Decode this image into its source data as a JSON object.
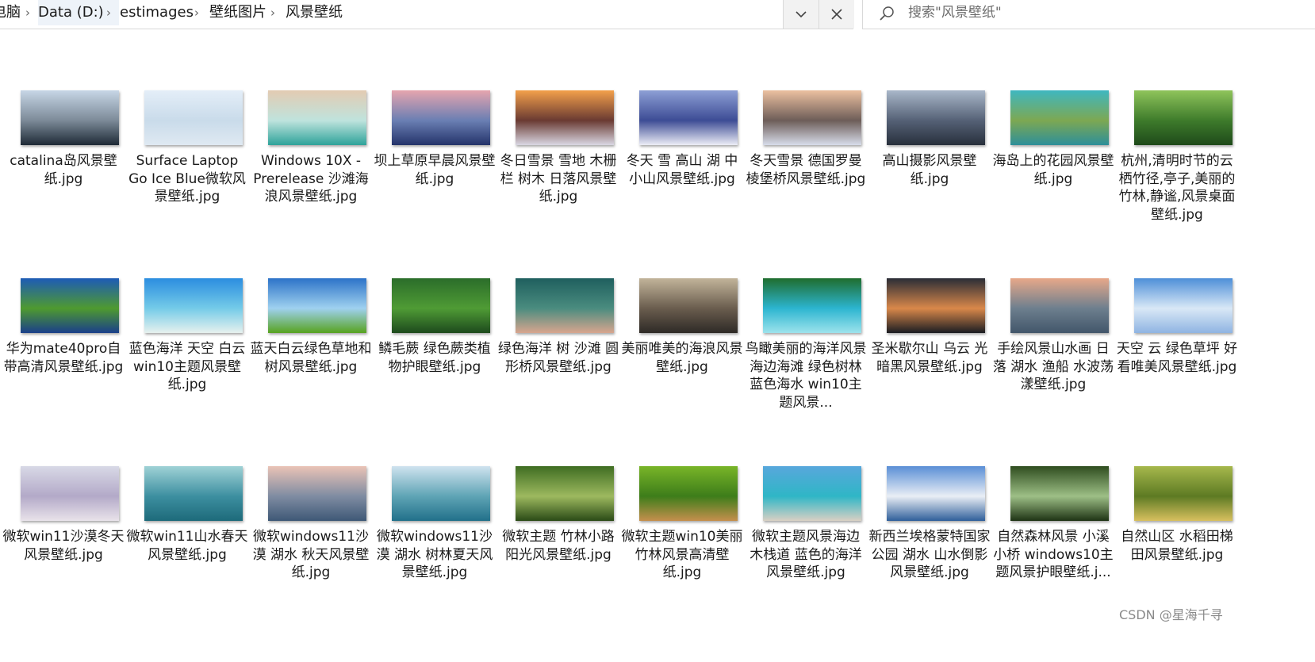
{
  "breadcrumb": {
    "items": [
      "电脑",
      "Data (D:)",
      "estimages",
      "壁纸图片",
      "风景壁纸"
    ]
  },
  "search": {
    "placeholder": "搜索\"风景壁纸\""
  },
  "icons": {
    "separator": "chevron-right-icon",
    "history_dropdown": "chevron-down-icon",
    "clear": "close-icon",
    "search": "search-icon"
  },
  "files": [
    {
      "name": "catalina岛风景壁纸.jpg",
      "colors": [
        "#c7d6e6",
        "#7c8a98",
        "#1e2a36"
      ]
    },
    {
      "name": "Surface Laptop Go Ice Blue微软风景壁纸.jpg",
      "colors": [
        "#e4eef8",
        "#c9dbea",
        "#dfe9f2"
      ]
    },
    {
      "name": "Windows 10X - Prerelease 沙滩海浪风景壁纸.jpg",
      "colors": [
        "#e3cbb2",
        "#bfe3dd",
        "#2ea39a"
      ]
    },
    {
      "name": "坝上草原早晨风景壁纸.jpg",
      "colors": [
        "#e6a5ae",
        "#6a7fb3",
        "#24336a"
      ]
    },
    {
      "name": "冬日雪景 雪地 木栅栏 树木 日落风景壁纸.jpg",
      "colors": [
        "#f3a04b",
        "#6a3a32",
        "#d9d7e3"
      ]
    },
    {
      "name": "冬天 雪 高山 湖 中小山风景壁纸.jpg",
      "colors": [
        "#8d9fd5",
        "#3d4c95",
        "#ecedf6"
      ]
    },
    {
      "name": "冬天雪景 德国罗曼棱堡桥风景壁纸.jpg",
      "colors": [
        "#ecc0a0",
        "#6d5d58",
        "#d7dcea"
      ]
    },
    {
      "name": "高山摄影风景壁纸.jpg",
      "colors": [
        "#a9b7c9",
        "#556176",
        "#28303c"
      ]
    },
    {
      "name": "海岛上的花园风景壁纸.jpg",
      "colors": [
        "#3fb7c0",
        "#7da852",
        "#2d8f9a"
      ]
    },
    {
      "name": "杭州,清明时节的云栖竹径,亭子,美丽的竹林,静谧,风景桌面壁纸.jpg",
      "colors": [
        "#8fc45b",
        "#3e7b2b",
        "#1f4a1a"
      ]
    },
    {
      "name": "华为mate40pro自带高清风景壁纸.jpg",
      "colors": [
        "#1d5bb6",
        "#4f9a2f",
        "#1a3f8a"
      ]
    },
    {
      "name": "蓝色海洋 天空 白云 win10主题风景壁纸.jpg",
      "colors": [
        "#2b8de0",
        "#74cbe8",
        "#e7f1ee"
      ]
    },
    {
      "name": "蓝天白云绿色草地和树风景壁纸.jpg",
      "colors": [
        "#2d73c8",
        "#9fd1ef",
        "#57a31f"
      ]
    },
    {
      "name": "鳞毛蕨 绿色蕨类植物护眼壁纸.jpg",
      "colors": [
        "#2b6d2a",
        "#4f9b35",
        "#1d4a1d"
      ]
    },
    {
      "name": "绿色海洋 树 沙滩 圆形桥风景壁纸.jpg",
      "colors": [
        "#1f5f5e",
        "#4a8c7f",
        "#d8a58e"
      ]
    },
    {
      "name": "美丽唯美的海浪风景壁纸.jpg",
      "colors": [
        "#c2b49a",
        "#6a5d4e",
        "#2e2a26"
      ]
    },
    {
      "name": "鸟瞰美丽的海洋风景 海边海滩 绿色树林 蓝色海水 win10主题风景...",
      "colors": [
        "#1f6d2e",
        "#2cb5d0",
        "#9de3ec"
      ]
    },
    {
      "name": "圣米歇尔山 乌云 光 暗黑风景壁纸.jpg",
      "colors": [
        "#2a2d36",
        "#d9884a",
        "#1a1c22"
      ]
    },
    {
      "name": "手绘风景山水画 日落 湖水 渔船 水波荡漾壁纸.jpg",
      "colors": [
        "#e7a889",
        "#6d7f8e",
        "#42566a"
      ]
    },
    {
      "name": "天空 云 绿色草坪 好看唯美风景壁纸.jpg",
      "colors": [
        "#4e8fd8",
        "#d9e8f6",
        "#8fb4e2"
      ]
    },
    {
      "name": "微软win11沙漠冬天风景壁纸.jpg",
      "colors": [
        "#d8d9e6",
        "#b3a9c8",
        "#e9e3ea"
      ]
    },
    {
      "name": "微软win11山水春天风景壁纸.jpg",
      "colors": [
        "#9fd2d6",
        "#3d8fa0",
        "#1d6a7a"
      ]
    },
    {
      "name": "微软windows11沙漠 湖水 秋天风景壁纸.jpg",
      "colors": [
        "#eac3b6",
        "#7f8ca2",
        "#3e5876"
      ]
    },
    {
      "name": "微软windows11沙漠 湖水 树林夏天风景壁纸.jpg",
      "colors": [
        "#cfe3ef",
        "#5fa4b5",
        "#21708a"
      ]
    },
    {
      "name": "微软主题 竹林小路阳光风景壁纸.jpg",
      "colors": [
        "#3f6d22",
        "#9db95f",
        "#2a4a16"
      ]
    },
    {
      "name": "微软主题win10美丽竹林风景高清壁纸.jpg",
      "colors": [
        "#79b528",
        "#3d7d1a",
        "#c58f4d"
      ]
    },
    {
      "name": "微软主题风景海边 木栈道 蓝色的海洋风景壁纸.jpg",
      "colors": [
        "#58a7dc",
        "#2fb6c6",
        "#d9d0c4"
      ]
    },
    {
      "name": "新西兰埃格蒙特国家公园 湖水 山水倒影风景壁纸.jpg",
      "colors": [
        "#5a8fd6",
        "#e9eef5",
        "#2f5f9a"
      ]
    },
    {
      "name": "自然森林风景 小溪 小桥 windows10主题风景护眼壁纸.j...",
      "colors": [
        "#2f4d1f",
        "#9dbf86",
        "#1e3314"
      ]
    },
    {
      "name": "自然山区 水稻田梯田风景壁纸.jpg",
      "colors": [
        "#a6b84c",
        "#5d7a23",
        "#d8c05f"
      ]
    }
  ],
  "watermark": "CSDN @星海千寻"
}
